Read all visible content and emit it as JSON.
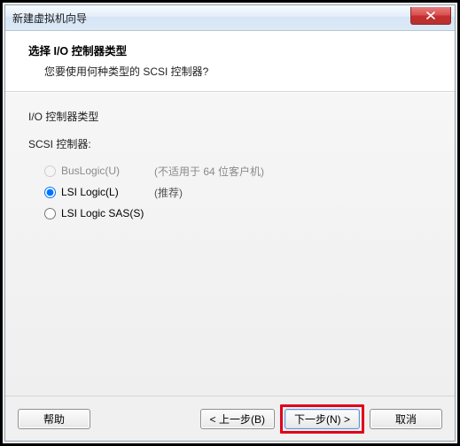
{
  "window": {
    "title": "新建虚拟机向导"
  },
  "header": {
    "title": "选择 I/O 控制器类型",
    "subtitle": "您要使用何种类型的 SCSI 控制器?"
  },
  "body": {
    "section_title": "I/O 控制器类型",
    "field_label": "SCSI 控制器:",
    "options": {
      "buslogic": {
        "label": "BusLogic(U)",
        "hint": "(不适用于 64 位客户机)"
      },
      "lsilogic": {
        "label": "LSI Logic(L)",
        "hint": "(推荐)"
      },
      "lsilogicsas": {
        "label": "LSI Logic SAS(S)",
        "hint": ""
      }
    }
  },
  "footer": {
    "help": "帮助",
    "back": "< 上一步(B)",
    "next": "下一步(N) >",
    "cancel": "取消"
  }
}
